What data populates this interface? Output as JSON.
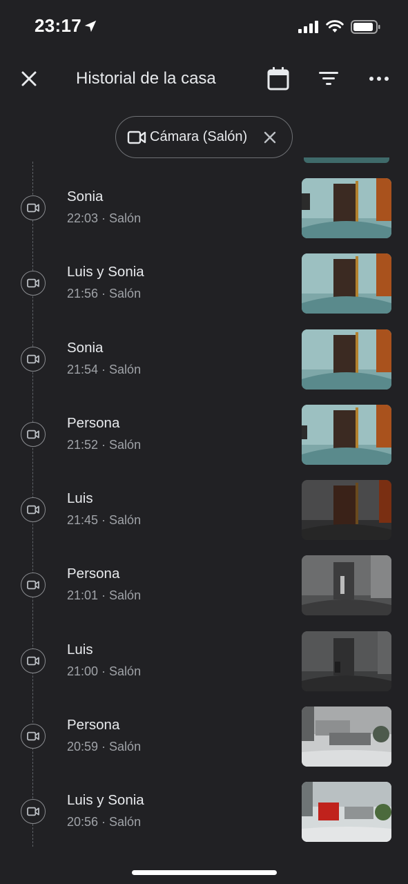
{
  "status_bar": {
    "time": "23:17",
    "icons": [
      "location-arrow-icon",
      "cellular-signal-icon",
      "wifi-icon",
      "battery-icon"
    ]
  },
  "header": {
    "title": "Historial de la casa",
    "icons": [
      "close-icon",
      "calendar-icon",
      "filter-icon",
      "more-icon"
    ]
  },
  "filter_chip": {
    "label": "Cámara (Salón)",
    "icon": "video-camera-icon"
  },
  "events": [
    {
      "title": "Sonia",
      "meta": "22:03 · Salón",
      "icon": "video-camera-icon"
    },
    {
      "title": "Luis y Sonia",
      "meta": "21:56 · Salón",
      "icon": "video-camera-icon"
    },
    {
      "title": "Sonia",
      "meta": "21:54 · Salón",
      "icon": "video-camera-icon"
    },
    {
      "title": "Persona",
      "meta": "21:52 · Salón",
      "icon": "video-camera-icon"
    },
    {
      "title": "Luis",
      "meta": "21:45 · Salón",
      "icon": "video-camera-icon"
    },
    {
      "title": "Persona",
      "meta": "21:01 · Salón",
      "icon": "video-camera-icon"
    },
    {
      "title": "Luis",
      "meta": "21:00 · Salón",
      "icon": "video-camera-icon"
    },
    {
      "title": "Persona",
      "meta": "20:59 · Salón",
      "icon": "video-camera-icon"
    },
    {
      "title": "Luis y Sonia",
      "meta": "20:56 · Salón",
      "icon": "video-camera-icon"
    }
  ],
  "colors": {
    "background": "#212124",
    "text_primary": "#e8eaed",
    "text_secondary": "#a0a3a8",
    "timeline": "#5f6368"
  }
}
